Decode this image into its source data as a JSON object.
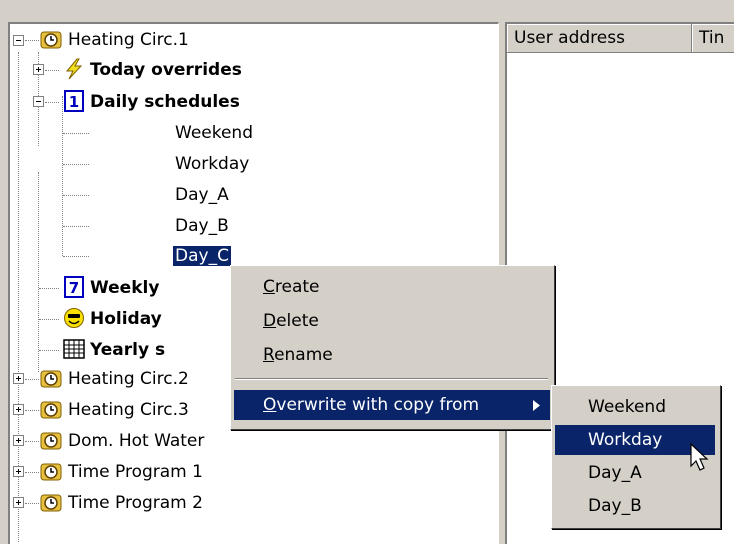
{
  "tree": {
    "items": [
      {
        "label": "Heating Circ.1",
        "icon": "clock-icon",
        "expanded": true
      },
      {
        "label": "Today overrides",
        "icon": "lightning-icon"
      },
      {
        "label": "Daily schedules",
        "icon": "calendar-1-icon",
        "expanded": true
      },
      {
        "label": "Weekend"
      },
      {
        "label": "Workday"
      },
      {
        "label": "Day_A"
      },
      {
        "label": "Day_B"
      },
      {
        "label": "Day_C",
        "selected": true
      },
      {
        "label": "Weekly",
        "icon": "calendar-7-icon"
      },
      {
        "label": "Holiday",
        "icon": "smiley-icon"
      },
      {
        "label": "Yearly s",
        "icon": "grid-calendar-icon"
      },
      {
        "label": "Heating Circ.2",
        "icon": "clock-icon"
      },
      {
        "label": "Heating Circ.3",
        "icon": "clock-icon"
      },
      {
        "label": "Dom. Hot Water",
        "icon": "clock-icon"
      },
      {
        "label": "Time Program 1",
        "icon": "clock-icon"
      },
      {
        "label": "Time Program 2",
        "icon": "clock-icon"
      }
    ]
  },
  "list": {
    "columns": [
      "User address",
      "Tin"
    ]
  },
  "context_menu": {
    "create": {
      "hotkey": "C",
      "rest": "reate"
    },
    "delete": {
      "hotkey": "D",
      "rest": "elete"
    },
    "rename": {
      "hotkey": "R",
      "rest": "ename"
    },
    "overwrite": {
      "hotkey": "O",
      "rest": "verwrite with copy from"
    }
  },
  "submenu": {
    "items": [
      "Weekend",
      "Workday",
      "Day_A",
      "Day_B"
    ],
    "highlighted": "Workday"
  },
  "colors": {
    "selection": "#0a246a",
    "face": "#d4d0c8"
  }
}
